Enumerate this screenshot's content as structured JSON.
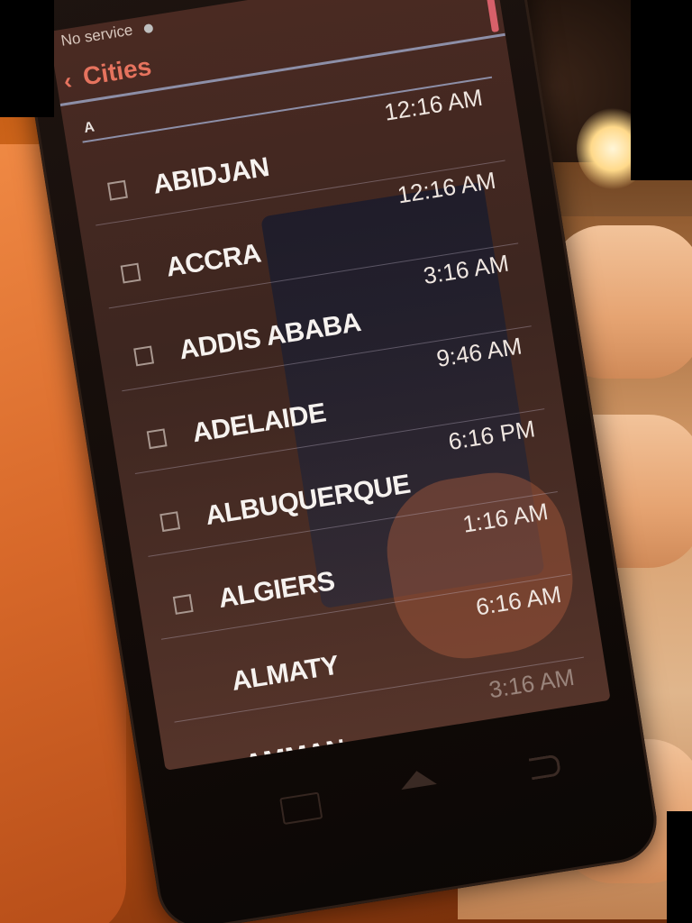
{
  "status_bar": {
    "carrier_text": "No service"
  },
  "action_bar": {
    "back_icon": "chevron-left-icon",
    "title": "Cities",
    "search_icon": "search-icon",
    "accent_color": "#e6735e"
  },
  "list": {
    "section_header": "A",
    "cities": [
      {
        "name": "ABIDJAN",
        "time": "12:16 AM"
      },
      {
        "name": "ACCRA",
        "time": "12:16 AM"
      },
      {
        "name": "ADDIS ABABA",
        "time": "3:16 AM"
      },
      {
        "name": "ADELAIDE",
        "time": "9:46 AM"
      },
      {
        "name": "ALBUQUERQUE",
        "time": "6:16 PM"
      },
      {
        "name": "ALGIERS",
        "time": "1:16 AM"
      },
      {
        "name": "ALMATY",
        "time": "6:16 AM"
      },
      {
        "name": "AMMAN",
        "time": "3:16 AM"
      }
    ]
  },
  "nav_bar": {
    "recents_icon": "recents-icon",
    "home_icon": "home-icon",
    "back_icon": "back-icon"
  }
}
